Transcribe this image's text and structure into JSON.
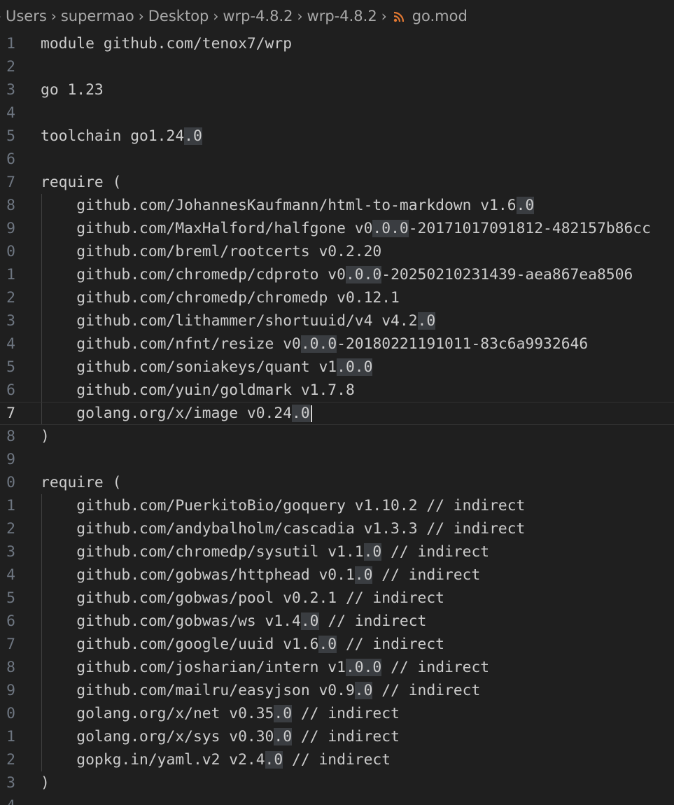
{
  "breadcrumb": {
    "items": [
      "Users",
      "supermao",
      "Desktop",
      "wrp-4.8.2",
      "wrp-4.8.2"
    ],
    "file": "go.mod",
    "file_icon": "rss-icon",
    "icon_color": "#e37933"
  },
  "editor": {
    "current_line": 17,
    "lines": [
      {
        "num": "1",
        "text": "module github.com/tenox7/wrp"
      },
      {
        "num": "2",
        "text": ""
      },
      {
        "num": "3",
        "text": "go 1.23"
      },
      {
        "num": "4",
        "text": ""
      },
      {
        "num": "5",
        "text": "toolchain go1.24.0"
      },
      {
        "num": "6",
        "text": ""
      },
      {
        "num": "7",
        "text": "require ("
      },
      {
        "num": "8",
        "text": "    github.com/JohannesKaufmann/html-to-markdown v1.6.0"
      },
      {
        "num": "9",
        "text": "    github.com/MaxHalford/halfgone v0.0.0-20171017091812-482157b86cc"
      },
      {
        "num": "0",
        "text": "    github.com/breml/rootcerts v0.2.20"
      },
      {
        "num": "1",
        "text": "    github.com/chromedp/cdproto v0.0.0-20250210231439-aea867ea8506"
      },
      {
        "num": "2",
        "text": "    github.com/chromedp/chromedp v0.12.1"
      },
      {
        "num": "3",
        "text": "    github.com/lithammer/shortuuid/v4 v4.2.0"
      },
      {
        "num": "4",
        "text": "    github.com/nfnt/resize v0.0.0-20180221191011-83c6a9932646"
      },
      {
        "num": "5",
        "text": "    github.com/soniakeys/quant v1.0.0"
      },
      {
        "num": "6",
        "text": "    github.com/yuin/goldmark v1.7.8"
      },
      {
        "num": "7",
        "text": "    golang.org/x/image v0.24.0"
      },
      {
        "num": "8",
        "text": ")"
      },
      {
        "num": "9",
        "text": ""
      },
      {
        "num": "0",
        "text": "require ("
      },
      {
        "num": "1",
        "text": "    github.com/PuerkitoBio/goquery v1.10.2 // indirect"
      },
      {
        "num": "2",
        "text": "    github.com/andybalholm/cascadia v1.3.3 // indirect"
      },
      {
        "num": "3",
        "text": "    github.com/chromedp/sysutil v1.1.0 // indirect"
      },
      {
        "num": "4",
        "text": "    github.com/gobwas/httphead v0.1.0 // indirect"
      },
      {
        "num": "5",
        "text": "    github.com/gobwas/pool v0.2.1 // indirect"
      },
      {
        "num": "6",
        "text": "    github.com/gobwas/ws v1.4.0 // indirect"
      },
      {
        "num": "7",
        "text": "    github.com/google/uuid v1.6.0 // indirect"
      },
      {
        "num": "8",
        "text": "    github.com/josharian/intern v1.0.0 // indirect"
      },
      {
        "num": "9",
        "text": "    github.com/mailru/easyjson v0.9.0 // indirect"
      },
      {
        "num": "0",
        "text": "    golang.org/x/net v0.35.0 // indirect"
      },
      {
        "num": "1",
        "text": "    golang.org/x/sys v0.30.0 // indirect"
      },
      {
        "num": "2",
        "text": "    gopkg.in/yaml.v2 v2.4.0 // indirect"
      },
      {
        "num": "3",
        "text": ")"
      },
      {
        "num": "4",
        "text": ""
      }
    ]
  },
  "colors": {
    "background": "#1f1f1f",
    "text": "#cccccc",
    "line_number": "#6e7681",
    "selection_highlight": "#3a3d41"
  }
}
